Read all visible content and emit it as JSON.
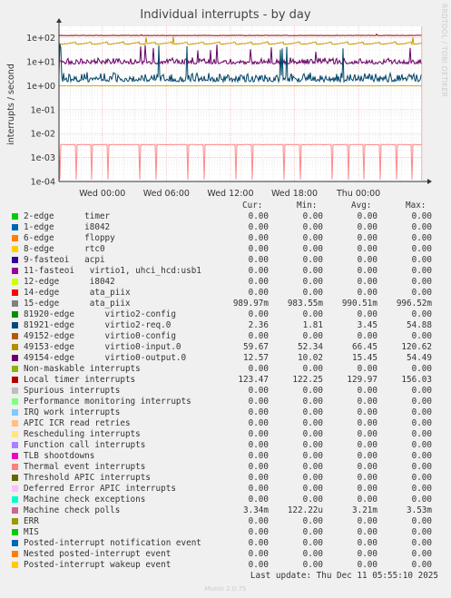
{
  "title": "Individual interrupts - by day",
  "side_label": "RRDTOOL / TOBI OETIKER",
  "footer": {
    "last_update": "Last update: Thu Dec 11 05:55:10 2025",
    "munin": "Munin 2.0.75"
  },
  "chart_data": {
    "type": "line",
    "title": "Individual interrupts - by day",
    "ylabel": "interrupts / second",
    "yscale": "log",
    "ylim": [
      0.0001,
      300
    ],
    "y_ticks": [
      "1e+02",
      "1e+01",
      "1e+00",
      "1e-01",
      "1e-02",
      "1e-03",
      "1e-04"
    ],
    "x_ticks": [
      "Wed 00:00",
      "Wed 06:00",
      "Wed 12:00",
      "Wed 18:00",
      "Thu 00:00"
    ],
    "x_tick_hours": [
      0,
      6,
      12,
      18,
      24
    ],
    "x_range_hours": [
      -4.06,
      29.94
    ],
    "series": [
      {
        "name": "Local timer interrupts",
        "color": "#990000",
        "min": 122.25,
        "avg": 129.97,
        "max": 156.03,
        "cur": 123.47,
        "shape": "flat"
      },
      {
        "name": "15-edge      ata_piix",
        "color": "#ccbb00",
        "min": 0.98355,
        "avg": 0.99051,
        "max": 0.99652,
        "cur": 0.98997,
        "shape": "base"
      },
      {
        "name": "49153-edge      virtio0-input.0",
        "color": "#cc9900",
        "min": 52.34,
        "avg": 66.45,
        "max": 120.62,
        "cur": 59.67,
        "shape": "scallop"
      },
      {
        "name": "49154-edge      virtio0-output.0",
        "color": "#660066",
        "min": 10.02,
        "avg": 15.45,
        "max": 54.49,
        "cur": 12.57,
        "shape": "noisy"
      },
      {
        "name": "81921-edge      virtio2-req.0",
        "color": "#004466",
        "min": 1.81,
        "avg": 3.45,
        "max": 54.88,
        "cur": 2.36,
        "shape": "noisy"
      },
      {
        "name": "Machine check polls",
        "color": "#ff8888",
        "min": 0.000122,
        "avg": 0.00321,
        "max": 0.00353,
        "cur": 0.00334,
        "shape": "polls"
      }
    ]
  },
  "legend": {
    "headers": {
      "cur": "Cur:",
      "min": "Min:",
      "avg": "Avg:",
      "max": "Max:"
    },
    "rows": [
      {
        "color": "#00cc00",
        "label": "2-edge      timer",
        "cur": "0.00",
        "min": "0.00",
        "avg": "0.00",
        "max": "0.00"
      },
      {
        "color": "#0066b3",
        "label": "1-edge      i8042",
        "cur": "0.00",
        "min": "0.00",
        "avg": "0.00",
        "max": "0.00"
      },
      {
        "color": "#ff8000",
        "label": "6-edge      floppy",
        "cur": "0.00",
        "min": "0.00",
        "avg": "0.00",
        "max": "0.00"
      },
      {
        "color": "#ffcc00",
        "label": "8-edge      rtc0",
        "cur": "0.00",
        "min": "0.00",
        "avg": "0.00",
        "max": "0.00"
      },
      {
        "color": "#330099",
        "label": "9-fasteoi   acpi",
        "cur": "0.00",
        "min": "0.00",
        "avg": "0.00",
        "max": "0.00"
      },
      {
        "color": "#990099",
        "label": "11-fasteoi   virtio1, uhci_hcd:usb1",
        "cur": "0.00",
        "min": "0.00",
        "avg": "0.00",
        "max": "0.00"
      },
      {
        "color": "#ccff00",
        "label": "12-edge      i8042",
        "cur": "0.00",
        "min": "0.00",
        "avg": "0.00",
        "max": "0.00"
      },
      {
        "color": "#ff0000",
        "label": "14-edge      ata_piix",
        "cur": "0.00",
        "min": "0.00",
        "avg": "0.00",
        "max": "0.00"
      },
      {
        "color": "#808080",
        "label": "15-edge      ata_piix",
        "cur": "989.97m",
        "min": "983.55m",
        "avg": "990.51m",
        "max": "996.52m"
      },
      {
        "color": "#008f00",
        "label": "81920-edge      virtio2-config",
        "cur": "0.00",
        "min": "0.00",
        "avg": "0.00",
        "max": "0.00"
      },
      {
        "color": "#00487d",
        "label": "81921-edge      virtio2-req.0",
        "cur": "2.36",
        "min": "1.81",
        "avg": "3.45",
        "max": "54.88"
      },
      {
        "color": "#b35a00",
        "label": "49152-edge      virtio0-config",
        "cur": "0.00",
        "min": "0.00",
        "avg": "0.00",
        "max": "0.00"
      },
      {
        "color": "#b38f00",
        "label": "49153-edge      virtio0-input.0",
        "cur": "59.67",
        "min": "52.34",
        "avg": "66.45",
        "max": "120.62"
      },
      {
        "color": "#6b006b",
        "label": "49154-edge      virtio0-output.0",
        "cur": "12.57",
        "min": "10.02",
        "avg": "15.45",
        "max": "54.49"
      },
      {
        "color": "#8fb300",
        "label": "Non-maskable interrupts",
        "cur": "0.00",
        "min": "0.00",
        "avg": "0.00",
        "max": "0.00"
      },
      {
        "color": "#b30000",
        "label": "Local timer interrupts",
        "cur": "123.47",
        "min": "122.25",
        "avg": "129.97",
        "max": "156.03"
      },
      {
        "color": "#bebebe",
        "label": "Spurious interrupts",
        "cur": "0.00",
        "min": "0.00",
        "avg": "0.00",
        "max": "0.00"
      },
      {
        "color": "#80ff80",
        "label": "Performance monitoring interrupts",
        "cur": "0.00",
        "min": "0.00",
        "avg": "0.00",
        "max": "0.00"
      },
      {
        "color": "#80c9ff",
        "label": "IRQ work interrupts",
        "cur": "0.00",
        "min": "0.00",
        "avg": "0.00",
        "max": "0.00"
      },
      {
        "color": "#ffc080",
        "label": "APIC ICR read retries",
        "cur": "0.00",
        "min": "0.00",
        "avg": "0.00",
        "max": "0.00"
      },
      {
        "color": "#ffe680",
        "label": "Rescheduling interrupts",
        "cur": "0.00",
        "min": "0.00",
        "avg": "0.00",
        "max": "0.00"
      },
      {
        "color": "#aa80ff",
        "label": "Function call interrupts",
        "cur": "0.00",
        "min": "0.00",
        "avg": "0.00",
        "max": "0.00"
      },
      {
        "color": "#ee00cc",
        "label": "TLB shootdowns",
        "cur": "0.00",
        "min": "0.00",
        "avg": "0.00",
        "max": "0.00"
      },
      {
        "color": "#ff8080",
        "label": "Thermal event interrupts",
        "cur": "0.00",
        "min": "0.00",
        "avg": "0.00",
        "max": "0.00"
      },
      {
        "color": "#666600",
        "label": "Threshold APIC interrupts",
        "cur": "0.00",
        "min": "0.00",
        "avg": "0.00",
        "max": "0.00"
      },
      {
        "color": "#ffbfff",
        "label": "Deferred Error APIC interrupts",
        "cur": "0.00",
        "min": "0.00",
        "avg": "0.00",
        "max": "0.00"
      },
      {
        "color": "#00ffcc",
        "label": "Machine check exceptions",
        "cur": "0.00",
        "min": "0.00",
        "avg": "0.00",
        "max": "0.00"
      },
      {
        "color": "#cc6699",
        "label": "Machine check polls",
        "cur": "3.34m",
        "min": "122.22u",
        "avg": "3.21m",
        "max": "3.53m"
      },
      {
        "color": "#999900",
        "label": "ERR",
        "cur": "0.00",
        "min": "0.00",
        "avg": "0.00",
        "max": "0.00"
      },
      {
        "color": "#00cc00",
        "label": "MIS",
        "cur": "0.00",
        "min": "0.00",
        "avg": "0.00",
        "max": "0.00"
      },
      {
        "color": "#0066b3",
        "label": "Posted-interrupt notification event",
        "cur": "0.00",
        "min": "0.00",
        "avg": "0.00",
        "max": "0.00"
      },
      {
        "color": "#ff8000",
        "label": "Nested posted-interrupt event",
        "cur": "0.00",
        "min": "0.00",
        "avg": "0.00",
        "max": "0.00"
      },
      {
        "color": "#ffcc00",
        "label": "Posted-interrupt wakeup event",
        "cur": "0.00",
        "min": "0.00",
        "avg": "0.00",
        "max": "0.00"
      }
    ]
  }
}
